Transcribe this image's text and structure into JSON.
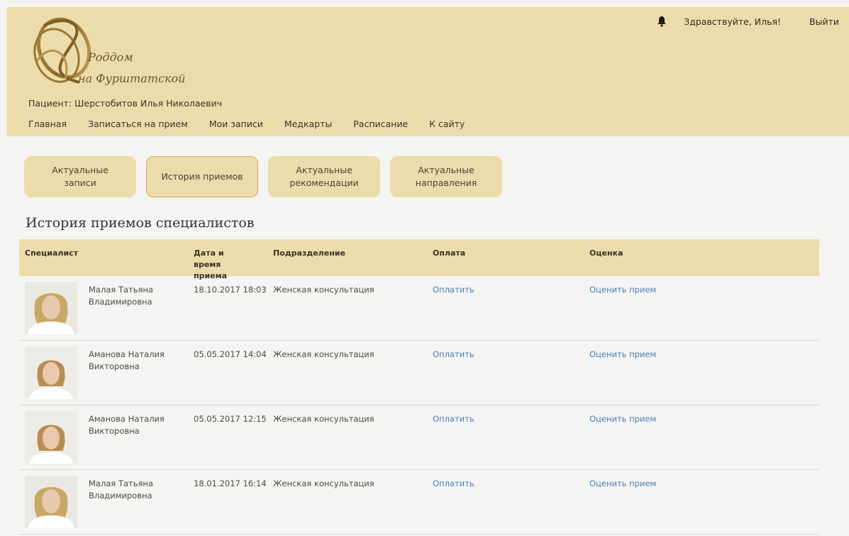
{
  "brand": {
    "logo_line1": "Роддом",
    "logo_line2": "на Фурштатской"
  },
  "header": {
    "patient": "Пациент: Шерстобитов Илья Николаевич",
    "greeting": "Здравствуйте, Илья!",
    "logout": "Выйти",
    "nav": [
      "Главная",
      "Записаться на прием",
      "Мои записи",
      "Медкарты",
      "Расписание",
      "К сайту"
    ]
  },
  "tabs": [
    {
      "label": "Актуальные записи",
      "active": false
    },
    {
      "label": "История приемов",
      "active": true
    },
    {
      "label": "Актуальные рекомендации",
      "active": false
    },
    {
      "label": "Актуальные направления",
      "active": false
    }
  ],
  "section_title": "История приемов специалистов",
  "table": {
    "headers": {
      "specialist": "Специалист",
      "datetime": "Дата и время приема",
      "department": "Подразделение",
      "payment": "Оплата",
      "rating": "Оценка"
    },
    "rows": [
      {
        "name": "Малая Татьяна Владимировна",
        "datetime": "18.10.2017 18:03",
        "department": "Женская консультация",
        "pay": "Оплатить",
        "rate": "Оценить прием",
        "photo": "doctor-1"
      },
      {
        "name": "Аманова Наталия Викторовна",
        "datetime": "05.05.2017 14:04",
        "department": "Женская консультация",
        "pay": "Оплатить",
        "rate": "Оценить прием",
        "photo": "doctor-2"
      },
      {
        "name": "Аманова Наталия Викторовна",
        "datetime": "05.05.2017 12:15",
        "department": "Женская консультация",
        "pay": "Оплатить",
        "rate": "Оценить прием",
        "photo": "doctor-2"
      },
      {
        "name": "Малая Татьяна Владимировна",
        "datetime": "18.01.2017 16:14",
        "department": "Женская консультация",
        "pay": "Оплатить",
        "rate": "Оценить прием",
        "photo": "doctor-1"
      }
    ]
  },
  "colors": {
    "accent": "#eddcab",
    "link": "#4a7fb5",
    "background": "#f4f4f2"
  },
  "icons": {
    "notification": "bell-icon"
  }
}
